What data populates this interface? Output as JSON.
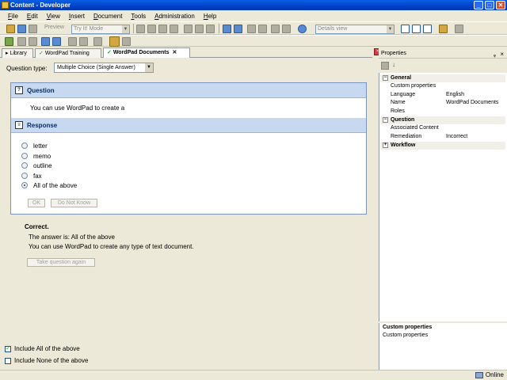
{
  "window": {
    "title": "Content - Developer",
    "min": "_",
    "max": "□",
    "close": "✕"
  },
  "menu": [
    "File",
    "Edit",
    "View",
    "Insert",
    "Document",
    "Tools",
    "Administration",
    "Help"
  ],
  "toolbar": {
    "preview_label": "Preview",
    "mode_combo": "Try It! Mode",
    "view_combo": "Details view"
  },
  "tabs": [
    {
      "label": "Library"
    },
    {
      "label": "WordPad Training"
    },
    {
      "label": "WordPad Documents",
      "close": "✕"
    }
  ],
  "editor": {
    "question_type_label": "Question type:",
    "question_type_value": "Multiple Choice (Single Answer)",
    "question_header": "Question",
    "question_text": "You can use WordPad to create a",
    "response_header": "Response",
    "options": [
      {
        "label": "letter",
        "selected": false
      },
      {
        "label": "memo",
        "selected": false
      },
      {
        "label": "outline",
        "selected": false
      },
      {
        "label": "fax",
        "selected": false
      },
      {
        "label": "All of the above",
        "selected": true
      }
    ],
    "ok_button": "OK",
    "dnk_button": "Do Not Know",
    "feedback_title": "Correct.",
    "feedback_answer": "The answer is: All of the above",
    "feedback_explanation": "You can use WordPad to create any type of text document.",
    "take_again_button": "Take question again",
    "include_all_label": "Include All of the above",
    "include_all_checked": true,
    "include_none_label": "Include None of the above",
    "include_none_checked": false
  },
  "properties": {
    "title": "Properties",
    "pin": "ᵩ",
    "close": "×",
    "categories": {
      "general": "General",
      "question": "Question",
      "workflow": "Workflow"
    },
    "rows": {
      "custom_properties": {
        "key": "Custom properties",
        "value": ""
      },
      "language": {
        "key": "Language",
        "value": "English"
      },
      "name": {
        "key": "Name",
        "value": "WordPad Documents"
      },
      "roles": {
        "key": "Roles",
        "value": ""
      },
      "associated_content": {
        "key": "Associated Content",
        "value": ""
      },
      "remediation": {
        "key": "Remediation",
        "value": "Incorrect"
      }
    },
    "desc_title": "Custom properties",
    "desc_text": "Custom properties"
  },
  "status": {
    "online": "Online"
  },
  "colors": {
    "section_header": "#c6d9f1",
    "titlebar": "#0a5fe4"
  }
}
